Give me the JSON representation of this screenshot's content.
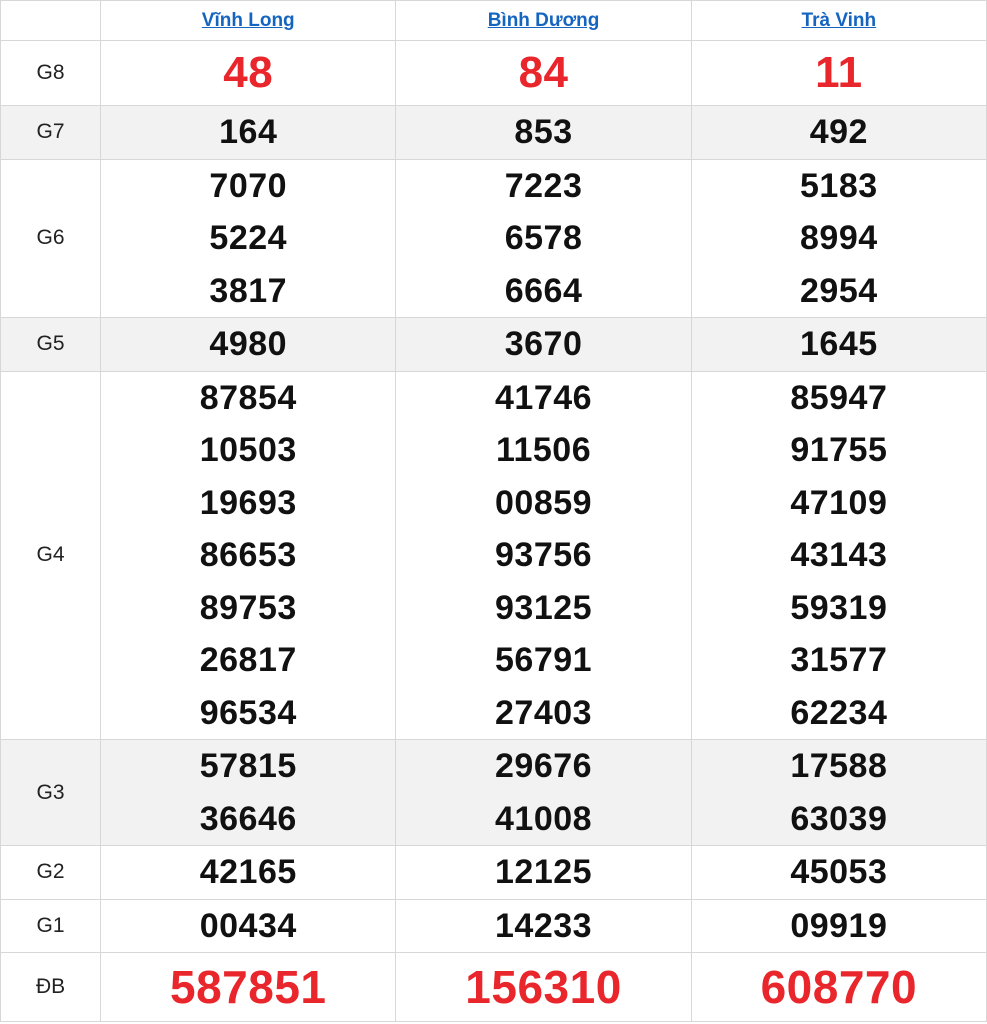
{
  "provinces": [
    "Vĩnh Long",
    "Bình Dương",
    "Trà Vinh"
  ],
  "prizes": [
    {
      "label": "G8",
      "numbers": [
        [
          "48"
        ],
        [
          "84"
        ],
        [
          "11"
        ]
      ]
    },
    {
      "label": "G7",
      "numbers": [
        [
          "164"
        ],
        [
          "853"
        ],
        [
          "492"
        ]
      ]
    },
    {
      "label": "G6",
      "numbers": [
        [
          "7070",
          "5224",
          "3817"
        ],
        [
          "7223",
          "6578",
          "6664"
        ],
        [
          "5183",
          "8994",
          "2954"
        ]
      ]
    },
    {
      "label": "G5",
      "numbers": [
        [
          "4980"
        ],
        [
          "3670"
        ],
        [
          "1645"
        ]
      ]
    },
    {
      "label": "G4",
      "numbers": [
        [
          "87854",
          "10503",
          "19693",
          "86653",
          "89753",
          "26817",
          "96534"
        ],
        [
          "41746",
          "11506",
          "00859",
          "93756",
          "93125",
          "56791",
          "27403"
        ],
        [
          "85947",
          "91755",
          "47109",
          "43143",
          "59319",
          "31577",
          "62234"
        ]
      ]
    },
    {
      "label": "G3",
      "numbers": [
        [
          "57815",
          "36646"
        ],
        [
          "29676",
          "41008"
        ],
        [
          "17588",
          "63039"
        ]
      ]
    },
    {
      "label": "G2",
      "numbers": [
        [
          "42165"
        ],
        [
          "12125"
        ],
        [
          "45053"
        ]
      ]
    },
    {
      "label": "G1",
      "numbers": [
        [
          "00434"
        ],
        [
          "14233"
        ],
        [
          "09919"
        ]
      ]
    },
    {
      "label": "ĐB",
      "numbers": [
        [
          "587851"
        ],
        [
          "156310"
        ],
        [
          "608770"
        ]
      ]
    }
  ],
  "colors": {
    "accent_red": "#e8262b",
    "link_blue": "#1565c0",
    "row_shade": "#f2f2f2"
  }
}
